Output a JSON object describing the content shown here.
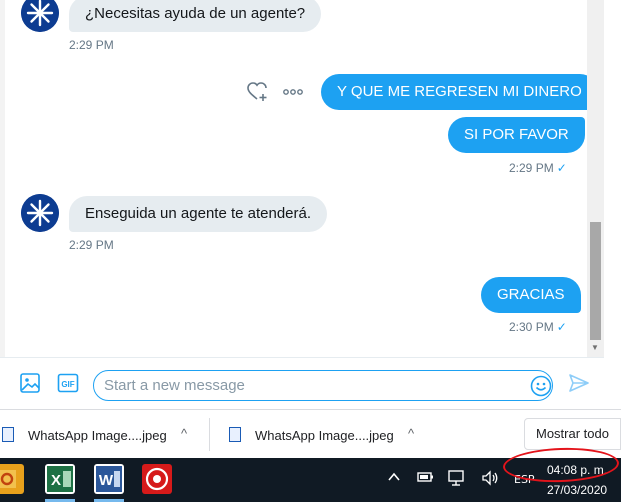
{
  "colors": {
    "accent": "#1da1f2",
    "incoming_bubble": "#e6ecf0",
    "timestamp": "#657786",
    "taskbar": "#101a24",
    "annotation_circle": "#e4141b"
  },
  "messages": [
    {
      "direction": "incoming",
      "text": "¿Necesitas ayuda de un agente?",
      "time": "2:29 PM",
      "avatar": "bot-avatar-icon"
    },
    {
      "direction": "outgoing",
      "text": "Y QUE ME REGRESEN MI DINERO"
    },
    {
      "direction": "outgoing",
      "text": "SI POR FAVOR",
      "time": "2:29 PM",
      "read_icon": "checkmark-icon"
    },
    {
      "direction": "incoming",
      "text": "Enseguida un agente te atenderá.",
      "time": "2:29 PM",
      "avatar": "bot-avatar-icon"
    },
    {
      "direction": "outgoing",
      "text": "GRACIAS",
      "time": "2:30 PM",
      "read_icon": "checkmark-icon"
    }
  ],
  "message_actions": {
    "icons": [
      "heart-plus-icon",
      "more-options-icon"
    ]
  },
  "check_glyph": "✓",
  "composer": {
    "placeholder": "Start a new message",
    "media_icon": "image-icon",
    "gif_label": "GIF",
    "emoji_icon": "emoji-icon",
    "send_icon": "send-icon"
  },
  "downloads": {
    "items": [
      {
        "name": "WhatsApp Image....jpeg",
        "icon": "image-file-icon",
        "menu_icon": "chevron-up-icon"
      },
      {
        "name": "WhatsApp Image....jpeg",
        "icon": "image-file-icon",
        "menu_icon": "chevron-up-icon"
      }
    ],
    "show_all_label": "Mostrar todo",
    "caret_glyph": "^"
  },
  "taskbar": {
    "apps": [
      "outlook-icon",
      "excel-icon",
      "word-icon",
      "antivirus-icon"
    ],
    "tray_icons": [
      "chevron-up-icon",
      "battery-icon",
      "network-icon",
      "volume-icon"
    ],
    "language": "ESP",
    "clock_time": "04:08 p. m.",
    "clock_date": "27/03/2020"
  }
}
